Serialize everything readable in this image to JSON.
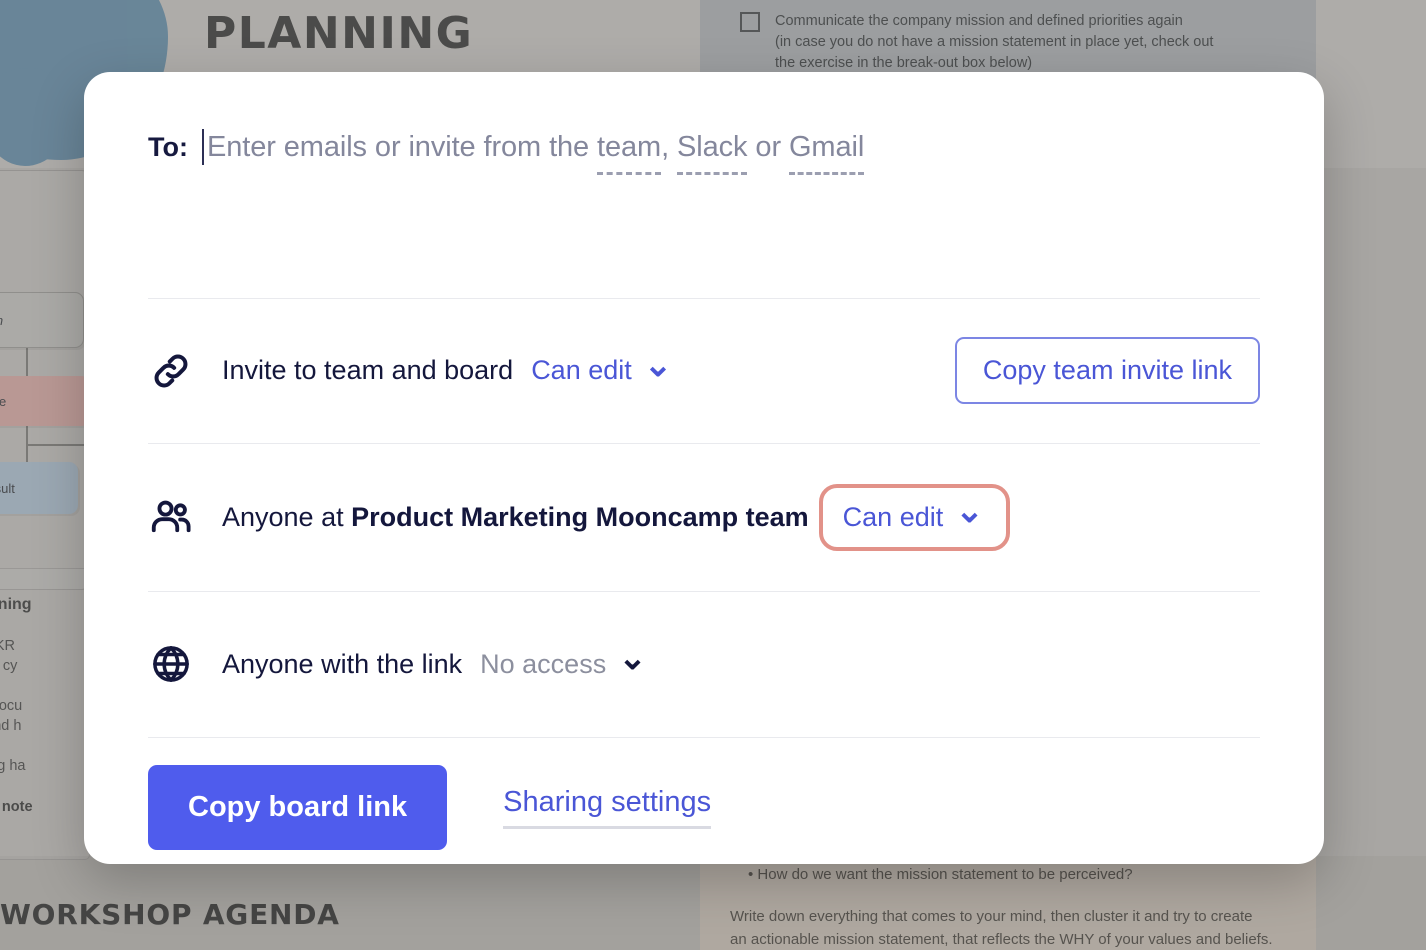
{
  "background": {
    "header_title": "PLANNING",
    "agenda_title": "WORKSHOP AGENDA",
    "checklist_text": "Communicate the company mission and defined priorities again\n(in case you do not have a mission statement in place yet, check out\nthe exercise in the break-out box below)",
    "bullet_text": "•   How do we want the mission statement to be perceived?",
    "paragraph": "Write down everything that comes to your mind, then cluster it and try to create\nan actionable mission statement, that reflects the WHY of your values and beliefs.",
    "okr": {
      "mission": "Mission",
      "objective": "Objective",
      "key_result": "Key Result"
    },
    "left_panel": {
      "title": "R Planning",
      "body": "ing the OKR\nupcoming cy\n\nmaintain focu\nectives and h\n\nR planning ha",
      "bold_line": "ck the note"
    }
  },
  "modal": {
    "to": {
      "label": "To:",
      "placeholder_lead": "Enter emails or invite from the ",
      "placeholder_team": "team",
      "placeholder_comma": ", ",
      "placeholder_slack": "Slack",
      "placeholder_or": " or ",
      "placeholder_gmail": "Gmail",
      "value": ""
    },
    "rows": [
      {
        "icon": "link-icon",
        "label": "Invite to team and board",
        "permission": "Can edit",
        "button": "Copy team invite link"
      },
      {
        "icon": "people-icon",
        "label_lead": "Anyone at ",
        "label_strong": "Product Marketing Mooncamp team",
        "permission": "Can edit"
      },
      {
        "icon": "globe-icon",
        "label": "Anyone with the link",
        "permission": "No access"
      }
    ],
    "footer": {
      "primary_button": "Copy board link",
      "settings_link": "Sharing settings"
    },
    "colors": {
      "accent": "#4f5ced",
      "accent_text": "#4a56d6",
      "highlight": "#e29289",
      "dark_text": "#14173c",
      "muted_text": "#8c8f9e"
    }
  }
}
